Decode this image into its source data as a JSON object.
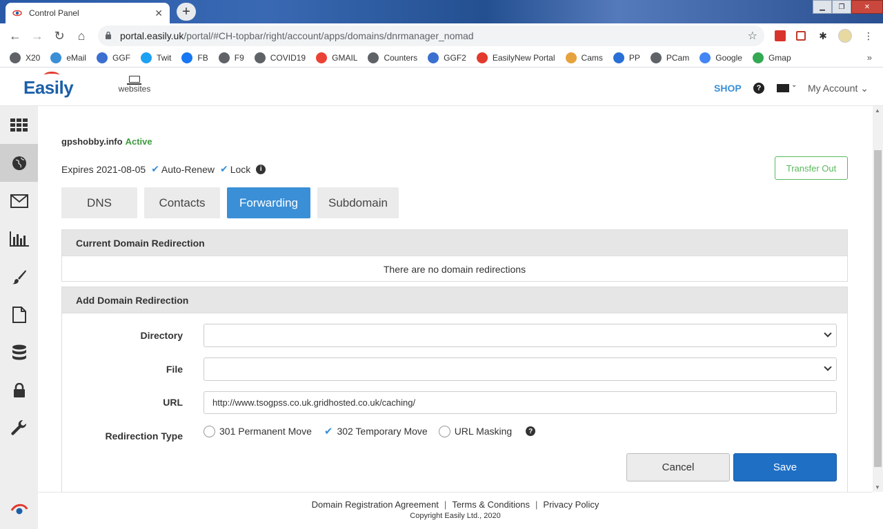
{
  "browser": {
    "tab_title": "Control Panel",
    "url_host": "portal.easily.uk",
    "url_path": "/portal/#CH-topbar/right/account/apps/domains/dnrmanager_nomad"
  },
  "bookmarks": [
    {
      "label": "X20",
      "icon": "globe-icon",
      "color": "#5f6368"
    },
    {
      "label": "eMail",
      "icon": "aol-icon",
      "color": "#3a8fd6"
    },
    {
      "label": "GGF",
      "icon": "ggf-icon",
      "color": "#3b6fd0"
    },
    {
      "label": "Twit",
      "icon": "twitter-icon",
      "color": "#1da1f2"
    },
    {
      "label": "FB",
      "icon": "facebook-icon",
      "color": "#1877f2"
    },
    {
      "label": "F9",
      "icon": "globe-icon",
      "color": "#5f6368"
    },
    {
      "label": "COVID19",
      "icon": "globe-icon",
      "color": "#5f6368"
    },
    {
      "label": "GMAIL",
      "icon": "google-icon",
      "color": "#ea4335"
    },
    {
      "label": "Counters",
      "icon": "globe-icon",
      "color": "#5f6368"
    },
    {
      "label": "GGF2",
      "icon": "ggf-icon",
      "color": "#3b6fd0"
    },
    {
      "label": "EasilyNew Portal",
      "icon": "easily-icon",
      "color": "#e23a2d"
    },
    {
      "label": "Cams",
      "icon": "cams-icon",
      "color": "#e6a23c"
    },
    {
      "label": "PP",
      "icon": "globe-color-icon",
      "color": "#2a6fd6"
    },
    {
      "label": "PCam",
      "icon": "globe-icon",
      "color": "#5f6368"
    },
    {
      "label": "Google",
      "icon": "google-icon",
      "color": "#4285f4"
    },
    {
      "label": "Gmap",
      "icon": "maps-icon",
      "color": "#34a853"
    }
  ],
  "header": {
    "logo": "Easily",
    "websites_label": "websites",
    "shop": "SHOP",
    "help": "?",
    "my_account": "My Account"
  },
  "domain": {
    "name": "gpshobby.info",
    "status": "Active",
    "expires": "Expires 2021-08-05",
    "auto_renew": "Auto-Renew",
    "lock": "Lock",
    "transfer_out": "Transfer Out"
  },
  "tabs": [
    "DNS",
    "Contacts",
    "Forwarding",
    "Subdomain"
  ],
  "current_section": {
    "title": "Current Domain Redirection",
    "empty_text": "There are no domain redirections"
  },
  "add_section": {
    "title": "Add Domain Redirection",
    "directory_label": "Directory",
    "directory_value": "",
    "file_label": "File",
    "file_value": "",
    "url_label": "URL",
    "url_value": "http://www.tsogpss.co.uk.gridhosted.co.uk/caching/",
    "redirection_type_label": "Redirection Type",
    "options": [
      "301 Permanent Move",
      "302 Temporary Move",
      "URL Masking"
    ],
    "selected_option": "302 Temporary Move",
    "cancel": "Cancel",
    "save": "Save"
  },
  "footer": {
    "link1": "Domain Registration Agreement",
    "link2": "Terms & Conditions",
    "link3": "Privacy Policy",
    "sep": "|",
    "copyright": "Copyright Easily Ltd., 2020"
  },
  "colors": {
    "accent": "#3a8fd6",
    "active_green": "#3c9a3c",
    "save_blue": "#1f6fc5"
  }
}
